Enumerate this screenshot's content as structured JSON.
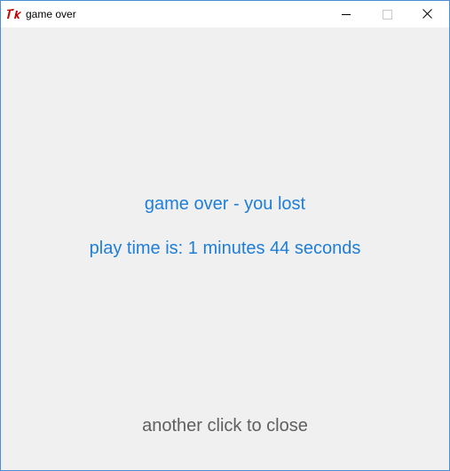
{
  "window": {
    "title": "game over",
    "app_icon": "tk-feather-icon",
    "controls": [
      "minimize-icon",
      "maximize-icon",
      "close-icon"
    ]
  },
  "content": {
    "headline": "game over - you lost",
    "play_time": "play time is: 1 minutes 44 seconds",
    "close_hint": "another click to close"
  },
  "colors": {
    "message": "#1e7ed8",
    "hint": "#5f5f5f",
    "background": "#f0f0f0",
    "border": "#4a90d0"
  }
}
